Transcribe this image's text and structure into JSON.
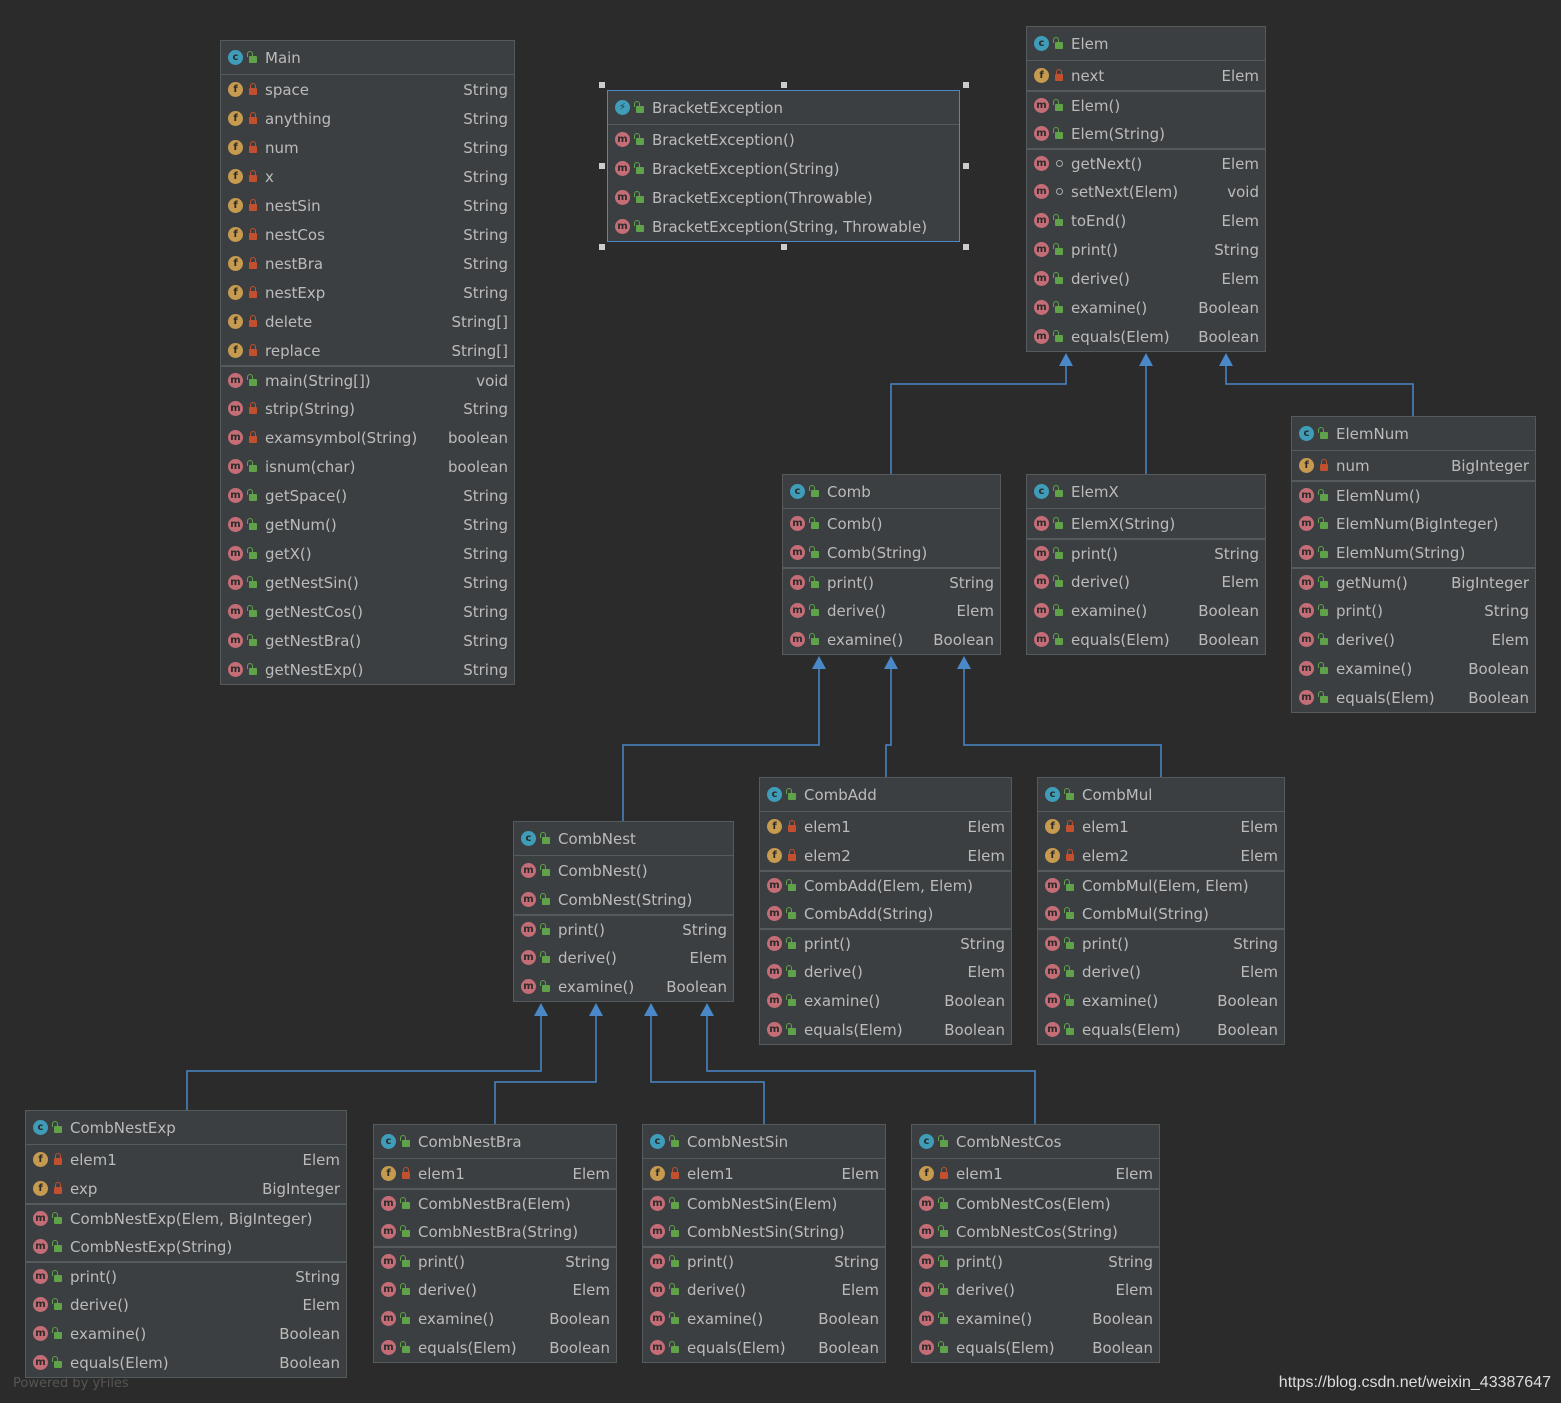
{
  "classes": [
    {
      "id": "main",
      "title": "Main",
      "kind": "class",
      "sections": [
        [
          {
            "k": "f",
            "v": "private",
            "n": "space",
            "t": "String"
          },
          {
            "k": "f",
            "v": "private",
            "n": "anything",
            "t": "String"
          },
          {
            "k": "f",
            "v": "private",
            "n": "num",
            "t": "String"
          },
          {
            "k": "f",
            "v": "private",
            "n": "x",
            "t": "String"
          },
          {
            "k": "f",
            "v": "private",
            "n": "nestSin",
            "t": "String"
          },
          {
            "k": "f",
            "v": "private",
            "n": "nestCos",
            "t": "String"
          },
          {
            "k": "f",
            "v": "private",
            "n": "nestBra",
            "t": "String"
          },
          {
            "k": "f",
            "v": "private",
            "n": "nestExp",
            "t": "String"
          },
          {
            "k": "f",
            "v": "private",
            "n": "delete",
            "t": "String[]"
          },
          {
            "k": "f",
            "v": "private",
            "n": "replace",
            "t": "String[]"
          }
        ],
        [
          {
            "k": "m",
            "v": "public",
            "n": "main(String[])",
            "t": "void"
          },
          {
            "k": "m",
            "v": "private",
            "n": "strip(String)",
            "t": "String"
          },
          {
            "k": "m",
            "v": "private",
            "n": "examsymbol(String)",
            "t": "boolean"
          },
          {
            "k": "m",
            "v": "public",
            "n": "isnum(char)",
            "t": "boolean"
          },
          {
            "k": "m",
            "v": "public",
            "n": "getSpace()",
            "t": "String"
          },
          {
            "k": "m",
            "v": "public",
            "n": "getNum()",
            "t": "String"
          },
          {
            "k": "m",
            "v": "public",
            "n": "getX()",
            "t": "String"
          },
          {
            "k": "m",
            "v": "public",
            "n": "getNestSin()",
            "t": "String"
          },
          {
            "k": "m",
            "v": "public",
            "n": "getNestCos()",
            "t": "String"
          },
          {
            "k": "m",
            "v": "public",
            "n": "getNestBra()",
            "t": "String"
          },
          {
            "k": "m",
            "v": "public",
            "n": "getNestExp()",
            "t": "String"
          }
        ]
      ]
    },
    {
      "id": "bracketexception",
      "title": "BracketException",
      "kind": "exception",
      "selected": true,
      "sections": [
        [
          {
            "k": "m",
            "v": "public",
            "n": "BracketException()",
            "t": ""
          },
          {
            "k": "m",
            "v": "public",
            "n": "BracketException(String)",
            "t": ""
          },
          {
            "k": "m",
            "v": "public",
            "n": "BracketException(Throwable)",
            "t": ""
          },
          {
            "k": "m",
            "v": "public",
            "n": "BracketException(String, Throwable)",
            "t": ""
          }
        ]
      ]
    },
    {
      "id": "elem",
      "title": "Elem",
      "kind": "class",
      "sections": [
        [
          {
            "k": "f",
            "v": "private",
            "n": "next",
            "t": "Elem"
          }
        ],
        [
          {
            "k": "m",
            "v": "public",
            "n": "Elem()",
            "t": ""
          },
          {
            "k": "m",
            "v": "public",
            "n": "Elem(String)",
            "t": ""
          }
        ],
        [
          {
            "k": "m",
            "v": "package",
            "n": "getNext()",
            "t": "Elem"
          },
          {
            "k": "m",
            "v": "package",
            "n": "setNext(Elem)",
            "t": "void"
          },
          {
            "k": "m",
            "v": "public",
            "n": "toEnd()",
            "t": "Elem"
          },
          {
            "k": "m",
            "v": "public",
            "n": "print()",
            "t": "String"
          },
          {
            "k": "m",
            "v": "public",
            "n": "derive()",
            "t": "Elem"
          },
          {
            "k": "m",
            "v": "public",
            "n": "examine()",
            "t": "Boolean"
          },
          {
            "k": "m",
            "v": "public",
            "n": "equals(Elem)",
            "t": "Boolean"
          }
        ]
      ]
    },
    {
      "id": "comb",
      "title": "Comb",
      "kind": "class",
      "sections": [
        [
          {
            "k": "m",
            "v": "public",
            "n": "Comb()",
            "t": ""
          },
          {
            "k": "m",
            "v": "public",
            "n": "Comb(String)",
            "t": ""
          }
        ],
        [
          {
            "k": "m",
            "v": "public",
            "n": "print()",
            "t": "String"
          },
          {
            "k": "m",
            "v": "public",
            "n": "derive()",
            "t": "Elem"
          },
          {
            "k": "m",
            "v": "public",
            "n": "examine()",
            "t": "Boolean"
          }
        ]
      ]
    },
    {
      "id": "elemx",
      "title": "ElemX",
      "kind": "class",
      "sections": [
        [
          {
            "k": "m",
            "v": "public",
            "n": "ElemX(String)",
            "t": ""
          }
        ],
        [
          {
            "k": "m",
            "v": "public",
            "n": "print()",
            "t": "String"
          },
          {
            "k": "m",
            "v": "public",
            "n": "derive()",
            "t": "Elem"
          },
          {
            "k": "m",
            "v": "public",
            "n": "examine()",
            "t": "Boolean"
          },
          {
            "k": "m",
            "v": "public",
            "n": "equals(Elem)",
            "t": "Boolean"
          }
        ]
      ]
    },
    {
      "id": "elemnum",
      "title": "ElemNum",
      "kind": "class",
      "sections": [
        [
          {
            "k": "f",
            "v": "private",
            "n": "num",
            "t": "BigInteger"
          }
        ],
        [
          {
            "k": "m",
            "v": "public",
            "n": "ElemNum()",
            "t": ""
          },
          {
            "k": "m",
            "v": "public",
            "n": "ElemNum(BigInteger)",
            "t": ""
          },
          {
            "k": "m",
            "v": "public",
            "n": "ElemNum(String)",
            "t": ""
          }
        ],
        [
          {
            "k": "m",
            "v": "public",
            "n": "getNum()",
            "t": "BigInteger"
          },
          {
            "k": "m",
            "v": "public",
            "n": "print()",
            "t": "String"
          },
          {
            "k": "m",
            "v": "public",
            "n": "derive()",
            "t": "Elem"
          },
          {
            "k": "m",
            "v": "public",
            "n": "examine()",
            "t": "Boolean"
          },
          {
            "k": "m",
            "v": "public",
            "n": "equals(Elem)",
            "t": "Boolean"
          }
        ]
      ]
    },
    {
      "id": "combnest",
      "title": "CombNest",
      "kind": "class",
      "sections": [
        [
          {
            "k": "m",
            "v": "public",
            "n": "CombNest()",
            "t": ""
          },
          {
            "k": "m",
            "v": "public",
            "n": "CombNest(String)",
            "t": ""
          }
        ],
        [
          {
            "k": "m",
            "v": "public",
            "n": "print()",
            "t": "String"
          },
          {
            "k": "m",
            "v": "public",
            "n": "derive()",
            "t": "Elem"
          },
          {
            "k": "m",
            "v": "public",
            "n": "examine()",
            "t": "Boolean"
          }
        ]
      ]
    },
    {
      "id": "combadd",
      "title": "CombAdd",
      "kind": "class",
      "sections": [
        [
          {
            "k": "f",
            "v": "private",
            "n": "elem1",
            "t": "Elem"
          },
          {
            "k": "f",
            "v": "private",
            "n": "elem2",
            "t": "Elem"
          }
        ],
        [
          {
            "k": "m",
            "v": "public",
            "n": "CombAdd(Elem, Elem)",
            "t": ""
          },
          {
            "k": "m",
            "v": "public",
            "n": "CombAdd(String)",
            "t": ""
          }
        ],
        [
          {
            "k": "m",
            "v": "public",
            "n": "print()",
            "t": "String"
          },
          {
            "k": "m",
            "v": "public",
            "n": "derive()",
            "t": "Elem"
          },
          {
            "k": "m",
            "v": "public",
            "n": "examine()",
            "t": "Boolean"
          },
          {
            "k": "m",
            "v": "public",
            "n": "equals(Elem)",
            "t": "Boolean"
          }
        ]
      ]
    },
    {
      "id": "combmul",
      "title": "CombMul",
      "kind": "class",
      "sections": [
        [
          {
            "k": "f",
            "v": "private",
            "n": "elem1",
            "t": "Elem"
          },
          {
            "k": "f",
            "v": "private",
            "n": "elem2",
            "t": "Elem"
          }
        ],
        [
          {
            "k": "m",
            "v": "public",
            "n": "CombMul(Elem, Elem)",
            "t": ""
          },
          {
            "k": "m",
            "v": "public",
            "n": "CombMul(String)",
            "t": ""
          }
        ],
        [
          {
            "k": "m",
            "v": "public",
            "n": "print()",
            "t": "String"
          },
          {
            "k": "m",
            "v": "public",
            "n": "derive()",
            "t": "Elem"
          },
          {
            "k": "m",
            "v": "public",
            "n": "examine()",
            "t": "Boolean"
          },
          {
            "k": "m",
            "v": "public",
            "n": "equals(Elem)",
            "t": "Boolean"
          }
        ]
      ]
    },
    {
      "id": "combnestexp",
      "title": "CombNestExp",
      "kind": "class",
      "sections": [
        [
          {
            "k": "f",
            "v": "private",
            "n": "elem1",
            "t": "Elem"
          },
          {
            "k": "f",
            "v": "private",
            "n": "exp",
            "t": "BigInteger"
          }
        ],
        [
          {
            "k": "m",
            "v": "public",
            "n": "CombNestExp(Elem, BigInteger)",
            "t": ""
          },
          {
            "k": "m",
            "v": "public",
            "n": "CombNestExp(String)",
            "t": ""
          }
        ],
        [
          {
            "k": "m",
            "v": "public",
            "n": "print()",
            "t": "String"
          },
          {
            "k": "m",
            "v": "public",
            "n": "derive()",
            "t": "Elem"
          },
          {
            "k": "m",
            "v": "public",
            "n": "examine()",
            "t": "Boolean"
          },
          {
            "k": "m",
            "v": "public",
            "n": "equals(Elem)",
            "t": "Boolean"
          }
        ]
      ]
    },
    {
      "id": "combnestbra",
      "title": "CombNestBra",
      "kind": "class",
      "sections": [
        [
          {
            "k": "f",
            "v": "private",
            "n": "elem1",
            "t": "Elem"
          }
        ],
        [
          {
            "k": "m",
            "v": "public",
            "n": "CombNestBra(Elem)",
            "t": ""
          },
          {
            "k": "m",
            "v": "public",
            "n": "CombNestBra(String)",
            "t": ""
          }
        ],
        [
          {
            "k": "m",
            "v": "public",
            "n": "print()",
            "t": "String"
          },
          {
            "k": "m",
            "v": "public",
            "n": "derive()",
            "t": "Elem"
          },
          {
            "k": "m",
            "v": "public",
            "n": "examine()",
            "t": "Boolean"
          },
          {
            "k": "m",
            "v": "public",
            "n": "equals(Elem)",
            "t": "Boolean"
          }
        ]
      ]
    },
    {
      "id": "combnestsin",
      "title": "CombNestSin",
      "kind": "class",
      "sections": [
        [
          {
            "k": "f",
            "v": "private",
            "n": "elem1",
            "t": "Elem"
          }
        ],
        [
          {
            "k": "m",
            "v": "public",
            "n": "CombNestSin(Elem)",
            "t": ""
          },
          {
            "k": "m",
            "v": "public",
            "n": "CombNestSin(String)",
            "t": ""
          }
        ],
        [
          {
            "k": "m",
            "v": "public",
            "n": "print()",
            "t": "String"
          },
          {
            "k": "m",
            "v": "public",
            "n": "derive()",
            "t": "Elem"
          },
          {
            "k": "m",
            "v": "public",
            "n": "examine()",
            "t": "Boolean"
          },
          {
            "k": "m",
            "v": "public",
            "n": "equals(Elem)",
            "t": "Boolean"
          }
        ]
      ]
    },
    {
      "id": "combnestcos",
      "title": "CombNestCos",
      "kind": "class",
      "sections": [
        [
          {
            "k": "f",
            "v": "private",
            "n": "elem1",
            "t": "Elem"
          }
        ],
        [
          {
            "k": "m",
            "v": "public",
            "n": "CombNestCos(Elem)",
            "t": ""
          },
          {
            "k": "m",
            "v": "public",
            "n": "CombNestCos(String)",
            "t": ""
          }
        ],
        [
          {
            "k": "m",
            "v": "public",
            "n": "print()",
            "t": "String"
          },
          {
            "k": "m",
            "v": "public",
            "n": "derive()",
            "t": "Elem"
          },
          {
            "k": "m",
            "v": "public",
            "n": "examine()",
            "t": "Boolean"
          },
          {
            "k": "m",
            "v": "public",
            "n": "equals(Elem)",
            "t": "Boolean"
          }
        ]
      ]
    }
  ],
  "inheritance": [
    {
      "child": "comb",
      "parent": "elem"
    },
    {
      "child": "elemx",
      "parent": "elem"
    },
    {
      "child": "elemnum",
      "parent": "elem"
    },
    {
      "child": "combnest",
      "parent": "comb"
    },
    {
      "child": "combadd",
      "parent": "comb"
    },
    {
      "child": "combmul",
      "parent": "comb"
    },
    {
      "child": "combnestexp",
      "parent": "combnest"
    },
    {
      "child": "combnestbra",
      "parent": "combnest"
    },
    {
      "child": "combnestsin",
      "parent": "combnest"
    },
    {
      "child": "combnestcos",
      "parent": "combnest"
    }
  ],
  "colors": {
    "edge": "#4a88c7",
    "background": "#2b2b2b",
    "panel": "#3c3f41"
  },
  "footer": {
    "powered": "Powered by yFiles",
    "url": "https://blog.csdn.net/weixin_43387647"
  }
}
